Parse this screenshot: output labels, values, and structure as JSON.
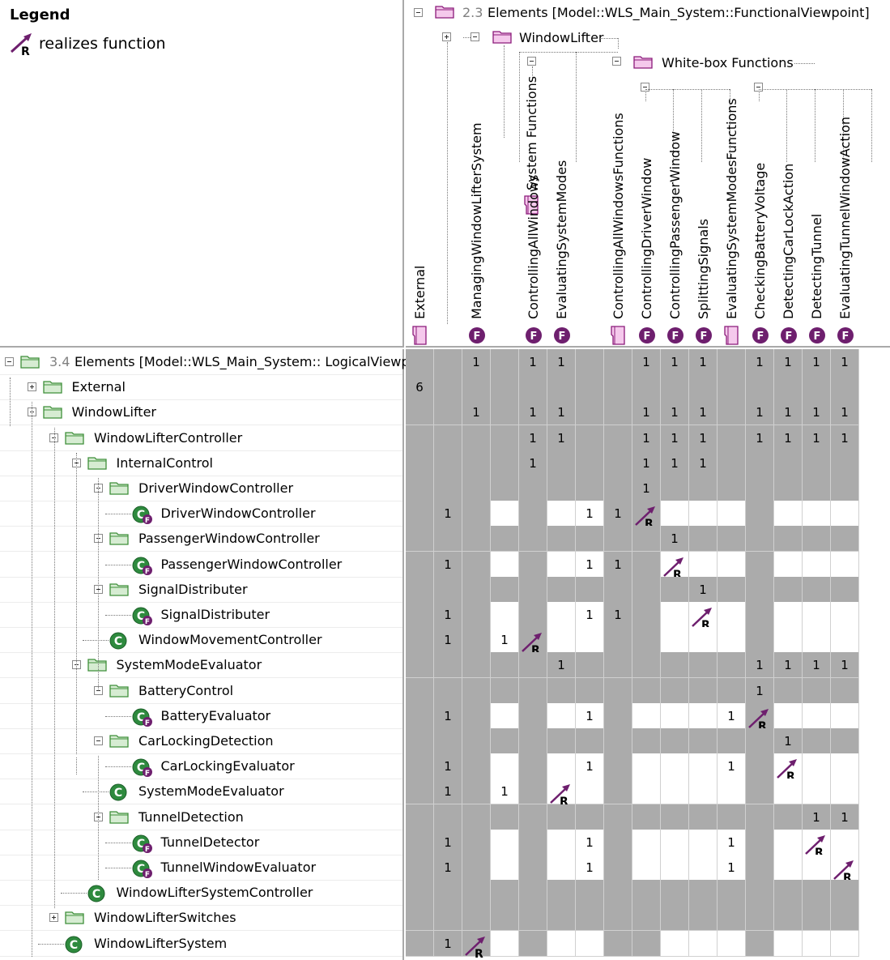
{
  "legend": {
    "title": "Legend",
    "arrow_letter": "R",
    "item": "realizes function",
    "arrow_color": "#6a1b6a"
  },
  "columns_header": {
    "root": {
      "number": "2.3",
      "text": "Elements [Model::WLS_Main_System::FunctionalViewpoint]"
    },
    "window_lifter": "WindowLifter",
    "white_box": "White-box Functions",
    "system_functions": "System Functions"
  },
  "columns": [
    {
      "label": "External",
      "icon": "package-icon"
    },
    {
      "label": "",
      "icon": "none"
    },
    {
      "label": "ManagingWindowLifterSystem",
      "icon": "function-icon"
    },
    {
      "label": "",
      "icon": "none"
    },
    {
      "label": "ControllingAllWindows",
      "icon": "function-icon"
    },
    {
      "label": "EvaluatingSystemModes",
      "icon": "function-icon"
    },
    {
      "label": "",
      "icon": "none"
    },
    {
      "label": "ControllingAllWindowsFunctions",
      "icon": "package-icon"
    },
    {
      "label": "ControllingDriverWindow",
      "icon": "function-icon"
    },
    {
      "label": "ControllingPassengerWindow",
      "icon": "function-icon"
    },
    {
      "label": "SplittingSignals",
      "icon": "function-icon"
    },
    {
      "label": "EvaluatingSystemModesFunctions",
      "icon": "package-icon"
    },
    {
      "label": "CheckingBatteryVoltage",
      "icon": "function-icon"
    },
    {
      "label": "DetectingCarLockAction",
      "icon": "function-icon"
    },
    {
      "label": "DetectingTunnel",
      "icon": "function-icon"
    },
    {
      "label": "EvaluatingTunnelWindowAction",
      "icon": "function-icon"
    }
  ],
  "rows": [
    {
      "label": "Elements [Model::WLS_Main_System:: LogicalViewp",
      "number": "3.4",
      "depth": 0,
      "icon": "package",
      "expander": "minus",
      "cells": [
        "g",
        "g",
        "g",
        "g",
        "g",
        "g",
        "g",
        "g",
        "g",
        "g",
        "g",
        "g",
        "g",
        "g",
        "g",
        "g"
      ],
      "values": [
        "",
        "",
        "",
        "1",
        "",
        "1",
        "1",
        "",
        "",
        "1",
        "1",
        "1",
        "",
        "1",
        "1",
        "1",
        "1"
      ]
    },
    {
      "label": "External",
      "depth": 1,
      "icon": "package",
      "expander": "plus",
      "cells": [
        "g",
        "g",
        "g",
        "g",
        "g",
        "g",
        "g",
        "g",
        "g",
        "g",
        "g",
        "g",
        "g",
        "g",
        "g",
        "g"
      ],
      "values": [
        "",
        "6",
        "",
        "",
        "",
        "",
        "",
        "",
        "",
        "",
        "",
        "",
        "",
        "",
        "",
        ""
      ]
    },
    {
      "label": "WindowLifter",
      "depth": 1,
      "icon": "package",
      "expander": "minus",
      "cells": [
        "g",
        "g",
        "g",
        "g",
        "g",
        "g",
        "g",
        "g",
        "g",
        "g",
        "g",
        "g",
        "g",
        "g",
        "g",
        "g"
      ],
      "values": [
        "",
        "",
        "",
        "1",
        "",
        "1",
        "1",
        "",
        "",
        "1",
        "1",
        "1",
        "",
        "1",
        "1",
        "1",
        "1"
      ]
    },
    {
      "label": "WindowLifterController",
      "depth": 2,
      "icon": "package",
      "expander": "minus",
      "cells": [
        "g",
        "g",
        "g",
        "g",
        "g",
        "g",
        "g",
        "g",
        "g",
        "g",
        "g",
        "g",
        "g",
        "g",
        "g",
        "g"
      ],
      "values": [
        "",
        "",
        "",
        "",
        "",
        "1",
        "1",
        "",
        "",
        "1",
        "1",
        "1",
        "",
        "1",
        "1",
        "1",
        "1"
      ]
    },
    {
      "label": "InternalControl",
      "depth": 3,
      "icon": "package",
      "expander": "minus",
      "cells": [
        "g",
        "g",
        "g",
        "g",
        "g",
        "g",
        "g",
        "g",
        "g",
        "g",
        "g",
        "g",
        "g",
        "g",
        "g",
        "g"
      ],
      "values": [
        "",
        "",
        "",
        "",
        "",
        "1",
        "",
        "",
        "",
        "1",
        "1",
        "1",
        "",
        "",
        "",
        ""
      ]
    },
    {
      "label": "DriverWindowController",
      "depth": 4,
      "icon": "package",
      "expander": "minus",
      "cells": [
        "g",
        "g",
        "g",
        "g",
        "g",
        "g",
        "g",
        "g",
        "g",
        "g",
        "g",
        "g",
        "g",
        "g",
        "g",
        "g"
      ],
      "values": [
        "",
        "",
        "",
        "",
        "",
        "",
        "",
        "",
        "",
        "1",
        "",
        "",
        "",
        "",
        "",
        ""
      ]
    },
    {
      "label": "DriverWindowController",
      "depth": 5,
      "icon": "component-f",
      "expander": "none",
      "cells": [
        "g",
        "g",
        "g",
        "w",
        "g",
        "w",
        "w",
        "g",
        "g",
        "w",
        "w",
        "w",
        "g",
        "w",
        "w",
        "w"
      ],
      "values": [
        "1",
        "",
        "1",
        "",
        "",
        "",
        "",
        "1",
        "1",
        "R",
        "",
        "",
        "",
        "",
        "",
        ""
      ]
    },
    {
      "label": "PassengerWindowController",
      "depth": 4,
      "icon": "package",
      "expander": "minus",
      "cells": [
        "g",
        "g",
        "g",
        "g",
        "g",
        "g",
        "g",
        "g",
        "g",
        "g",
        "g",
        "g",
        "g",
        "g",
        "g",
        "g"
      ],
      "values": [
        "",
        "",
        "",
        "",
        "",
        "",
        "",
        "",
        "",
        "",
        "1",
        "",
        "",
        "",
        "",
        ""
      ]
    },
    {
      "label": "PassengerWindowController",
      "depth": 5,
      "icon": "component-f",
      "expander": "none",
      "cells": [
        "g",
        "g",
        "g",
        "w",
        "g",
        "w",
        "w",
        "g",
        "g",
        "w",
        "w",
        "w",
        "g",
        "w",
        "w",
        "w"
      ],
      "values": [
        "1",
        "",
        "1",
        "",
        "",
        "",
        "",
        "1",
        "1",
        "",
        "R",
        "",
        "",
        "",
        "",
        ""
      ]
    },
    {
      "label": "SignalDistributer",
      "depth": 4,
      "icon": "package",
      "expander": "minus",
      "cells": [
        "g",
        "g",
        "g",
        "g",
        "g",
        "g",
        "g",
        "g",
        "g",
        "g",
        "g",
        "g",
        "g",
        "g",
        "g",
        "g"
      ],
      "values": [
        "",
        "",
        "",
        "",
        "",
        "",
        "",
        "",
        "",
        "",
        "",
        "1",
        "",
        "",
        "",
        ""
      ]
    },
    {
      "label": "SignalDistributer",
      "depth": 5,
      "icon": "component-f",
      "expander": "none",
      "cells": [
        "g",
        "g",
        "g",
        "w",
        "g",
        "w",
        "w",
        "g",
        "g",
        "w",
        "w",
        "w",
        "g",
        "w",
        "w",
        "w"
      ],
      "values": [
        "1",
        "",
        "1",
        "",
        "",
        "",
        "",
        "1",
        "1",
        "",
        "",
        "R",
        "",
        "",
        "",
        ""
      ]
    },
    {
      "label": "WindowMovementController",
      "depth": 4,
      "icon": "component",
      "expander": "none",
      "cells": [
        "g",
        "g",
        "g",
        "w",
        "g",
        "w",
        "w",
        "g",
        "g",
        "w",
        "w",
        "w",
        "g",
        "w",
        "w",
        "w"
      ],
      "values": [
        "1",
        "",
        "1",
        "",
        "1",
        "R",
        "",
        "",
        "",
        "",
        "",
        "",
        "",
        "",
        "",
        ""
      ]
    },
    {
      "label": "SystemModeEvaluator",
      "depth": 3,
      "icon": "package",
      "expander": "minus",
      "cells": [
        "g",
        "g",
        "g",
        "g",
        "g",
        "g",
        "g",
        "g",
        "g",
        "g",
        "g",
        "g",
        "g",
        "g",
        "g",
        "g"
      ],
      "values": [
        "",
        "",
        "",
        "",
        "",
        "",
        "1",
        "",
        "",
        "",
        "",
        "",
        "",
        "1",
        "1",
        "1",
        "1"
      ]
    },
    {
      "label": "BatteryControl",
      "depth": 4,
      "icon": "package",
      "expander": "minus",
      "cells": [
        "g",
        "g",
        "g",
        "g",
        "g",
        "g",
        "g",
        "g",
        "g",
        "g",
        "g",
        "g",
        "g",
        "g",
        "g",
        "g"
      ],
      "values": [
        "",
        "",
        "",
        "",
        "",
        "",
        "",
        "",
        "",
        "",
        "",
        "",
        "",
        "1",
        "",
        ""
      ]
    },
    {
      "label": "BatteryEvaluator",
      "depth": 5,
      "icon": "component-f",
      "expander": "none",
      "cells": [
        "g",
        "g",
        "g",
        "w",
        "g",
        "w",
        "w",
        "g",
        "w",
        "w",
        "w",
        "w",
        "g",
        "w",
        "w",
        "w"
      ],
      "values": [
        "1",
        "",
        "1",
        "",
        "",
        "",
        "",
        "1",
        "",
        "",
        "",
        "",
        "1",
        "R",
        "",
        ""
      ]
    },
    {
      "label": "CarLockingDetection",
      "depth": 4,
      "icon": "package",
      "expander": "minus",
      "cells": [
        "g",
        "g",
        "g",
        "g",
        "g",
        "g",
        "g",
        "g",
        "g",
        "g",
        "g",
        "g",
        "g",
        "g",
        "g",
        "g"
      ],
      "values": [
        "",
        "",
        "",
        "",
        "",
        "",
        "",
        "",
        "",
        "",
        "",
        "",
        "",
        "",
        "1",
        ""
      ]
    },
    {
      "label": "CarLockingEvaluator",
      "depth": 5,
      "icon": "component-f",
      "expander": "none",
      "cells": [
        "g",
        "g",
        "g",
        "w",
        "g",
        "w",
        "w",
        "g",
        "w",
        "w",
        "w",
        "w",
        "g",
        "w",
        "w",
        "w"
      ],
      "values": [
        "1",
        "",
        "1",
        "",
        "",
        "",
        "",
        "1",
        "",
        "",
        "",
        "",
        "1",
        "",
        "R",
        ""
      ]
    },
    {
      "label": "SystemModeEvaluator",
      "depth": 4,
      "icon": "component",
      "expander": "none",
      "cells": [
        "g",
        "g",
        "g",
        "w",
        "g",
        "w",
        "w",
        "g",
        "w",
        "w",
        "w",
        "w",
        "g",
        "w",
        "w",
        "w"
      ],
      "values": [
        "1",
        "",
        "1",
        "",
        "1",
        "",
        "R",
        "",
        "",
        "",
        "",
        "",
        "",
        "",
        "",
        ""
      ]
    },
    {
      "label": "TunnelDetection",
      "depth": 4,
      "icon": "package",
      "expander": "minus",
      "cells": [
        "g",
        "g",
        "g",
        "g",
        "g",
        "g",
        "g",
        "g",
        "g",
        "g",
        "g",
        "g",
        "g",
        "g",
        "g",
        "g"
      ],
      "values": [
        "",
        "",
        "",
        "",
        "",
        "",
        "",
        "",
        "",
        "",
        "",
        "",
        "",
        "",
        "",
        "1",
        "1"
      ]
    },
    {
      "label": "TunnelDetector",
      "depth": 5,
      "icon": "component-f",
      "expander": "none",
      "cells": [
        "g",
        "g",
        "g",
        "w",
        "g",
        "w",
        "w",
        "g",
        "w",
        "w",
        "w",
        "w",
        "g",
        "w",
        "w",
        "w"
      ],
      "values": [
        "1",
        "",
        "1",
        "",
        "",
        "",
        "",
        "1",
        "",
        "",
        "",
        "",
        "1",
        "",
        "",
        "R"
      ]
    },
    {
      "label": "TunnelWindowEvaluator",
      "depth": 5,
      "icon": "component-f",
      "expander": "none",
      "cells": [
        "g",
        "g",
        "g",
        "w",
        "g",
        "w",
        "w",
        "g",
        "w",
        "w",
        "w",
        "w",
        "g",
        "w",
        "w",
        "w"
      ],
      "values": [
        "1",
        "",
        "1",
        "",
        "",
        "",
        "",
        "1",
        "",
        "",
        "",
        "",
        "1",
        "",
        "",
        "",
        "R"
      ]
    },
    {
      "label": "WindowLifterSystemController",
      "depth": 3,
      "icon": "component",
      "expander": "none",
      "cells": [
        "g",
        "g",
        "g",
        "g",
        "g",
        "g",
        "g",
        "g",
        "g",
        "g",
        "g",
        "g",
        "g",
        "g",
        "g",
        "g"
      ],
      "values": [
        "",
        "",
        "",
        "",
        "",
        "",
        "",
        "",
        "",
        "",
        "",
        "",
        "",
        "",
        "",
        ""
      ]
    },
    {
      "label": "WindowLifterSwitches",
      "depth": 2,
      "icon": "package",
      "expander": "plus",
      "cells": [
        "g",
        "g",
        "g",
        "g",
        "g",
        "g",
        "g",
        "g",
        "g",
        "g",
        "g",
        "g",
        "g",
        "g",
        "g",
        "g"
      ],
      "values": [
        "",
        "",
        "",
        "",
        "",
        "",
        "",
        "",
        "",
        "",
        "",
        "",
        "",
        "",
        "",
        ""
      ]
    },
    {
      "label": "WindowLifterSystem",
      "depth": 2,
      "icon": "component",
      "expander": "none",
      "cells": [
        "g",
        "g",
        "g",
        "w",
        "g",
        "w",
        "w",
        "g",
        "g",
        "w",
        "w",
        "w",
        "g",
        "w",
        "w",
        "w"
      ],
      "values": [
        "1",
        "",
        "1",
        "R",
        "",
        "",
        "",
        "",
        "",
        "",
        "",
        "",
        "",
        "",
        "",
        ""
      ]
    }
  ],
  "colors": {
    "gray_cell": "#ababab",
    "package_green_fill": "#d6ecd2",
    "package_green_stroke": "#3f8f3a",
    "package_pink_fill": "#f5c9ec",
    "package_pink_stroke": "#8b1a7a",
    "component_green": "#2e8a3e",
    "function_purple": "#6e1f6e"
  }
}
